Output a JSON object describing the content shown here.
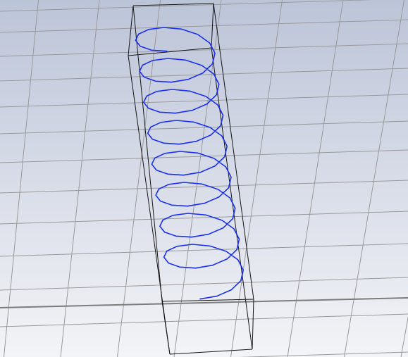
{
  "viewport": {
    "background_top": "#bcc4d8",
    "background_bottom": "#f3f4f7",
    "grid_color": "#9a9a9a",
    "axis_color": "#7d7d7d",
    "bbox_color": "#151515",
    "helix_color": "#1a2ff0",
    "helix_turns": 8
  }
}
